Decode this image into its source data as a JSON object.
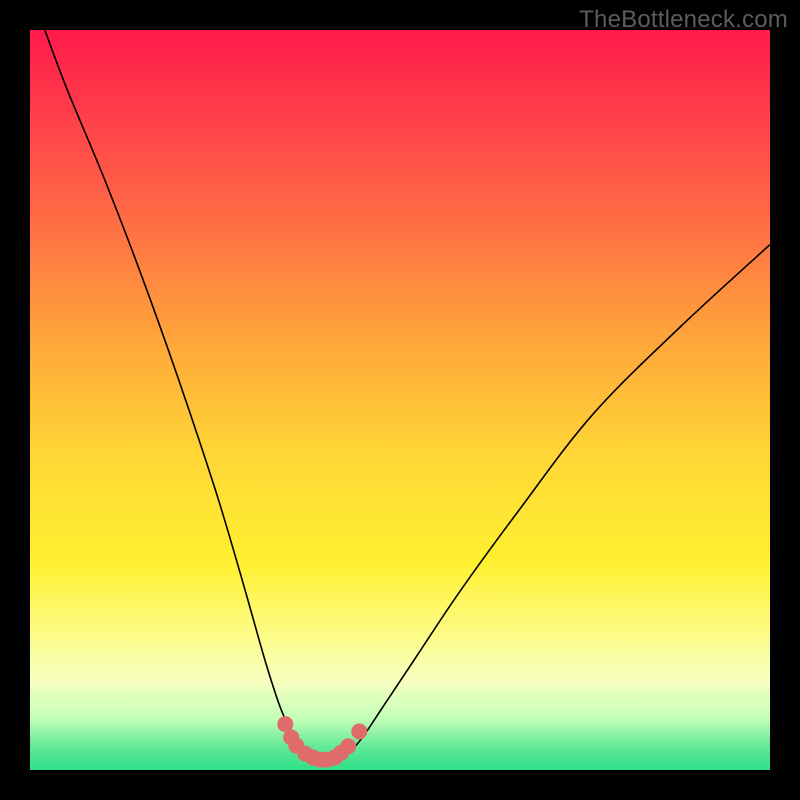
{
  "watermark": "TheBottleneck.com",
  "chart_data": {
    "type": "line",
    "title": "",
    "xlabel": "",
    "ylabel": "",
    "xlim": [
      0,
      100
    ],
    "ylim": [
      0,
      100
    ],
    "series": [
      {
        "name": "bottleneck-curve",
        "x": [
          2,
          5,
          10,
          15,
          20,
          25,
          28,
          30,
          32,
          34,
          36,
          37,
          38,
          39,
          40,
          41,
          42,
          43,
          45,
          48,
          52,
          58,
          66,
          76,
          88,
          100
        ],
        "values": [
          100,
          92,
          80,
          67,
          53,
          38,
          28,
          21,
          14,
          8,
          4,
          2.2,
          1.6,
          1.3,
          1.2,
          1.3,
          1.6,
          2.2,
          4.5,
          9,
          15,
          24,
          35,
          48,
          60,
          71
        ]
      }
    ],
    "markers": {
      "name": "highlight-dots",
      "color": "#e06b6b",
      "x": [
        34.5,
        35.3,
        36.0,
        37.2,
        38.2,
        39.2,
        40.2,
        41.2,
        42.0,
        43.0,
        44.5
      ],
      "values": [
        6.2,
        4.4,
        3.3,
        2.2,
        1.7,
        1.4,
        1.4,
        1.7,
        2.3,
        3.2,
        5.2
      ]
    },
    "background_gradient": {
      "stops": [
        {
          "pos": 0.0,
          "color": "#ff1a4b"
        },
        {
          "pos": 0.1,
          "color": "#ff3a4a"
        },
        {
          "pos": 0.25,
          "color": "#ff6a45"
        },
        {
          "pos": 0.42,
          "color": "#ffa63a"
        },
        {
          "pos": 0.58,
          "color": "#ffd836"
        },
        {
          "pos": 0.72,
          "color": "#fff030"
        },
        {
          "pos": 0.82,
          "color": "#fdfc8a"
        },
        {
          "pos": 0.88,
          "color": "#f6ffc0"
        },
        {
          "pos": 0.93,
          "color": "#c4ffb8"
        },
        {
          "pos": 0.97,
          "color": "#5fe896"
        },
        {
          "pos": 1.0,
          "color": "#2ee08a"
        }
      ]
    }
  }
}
